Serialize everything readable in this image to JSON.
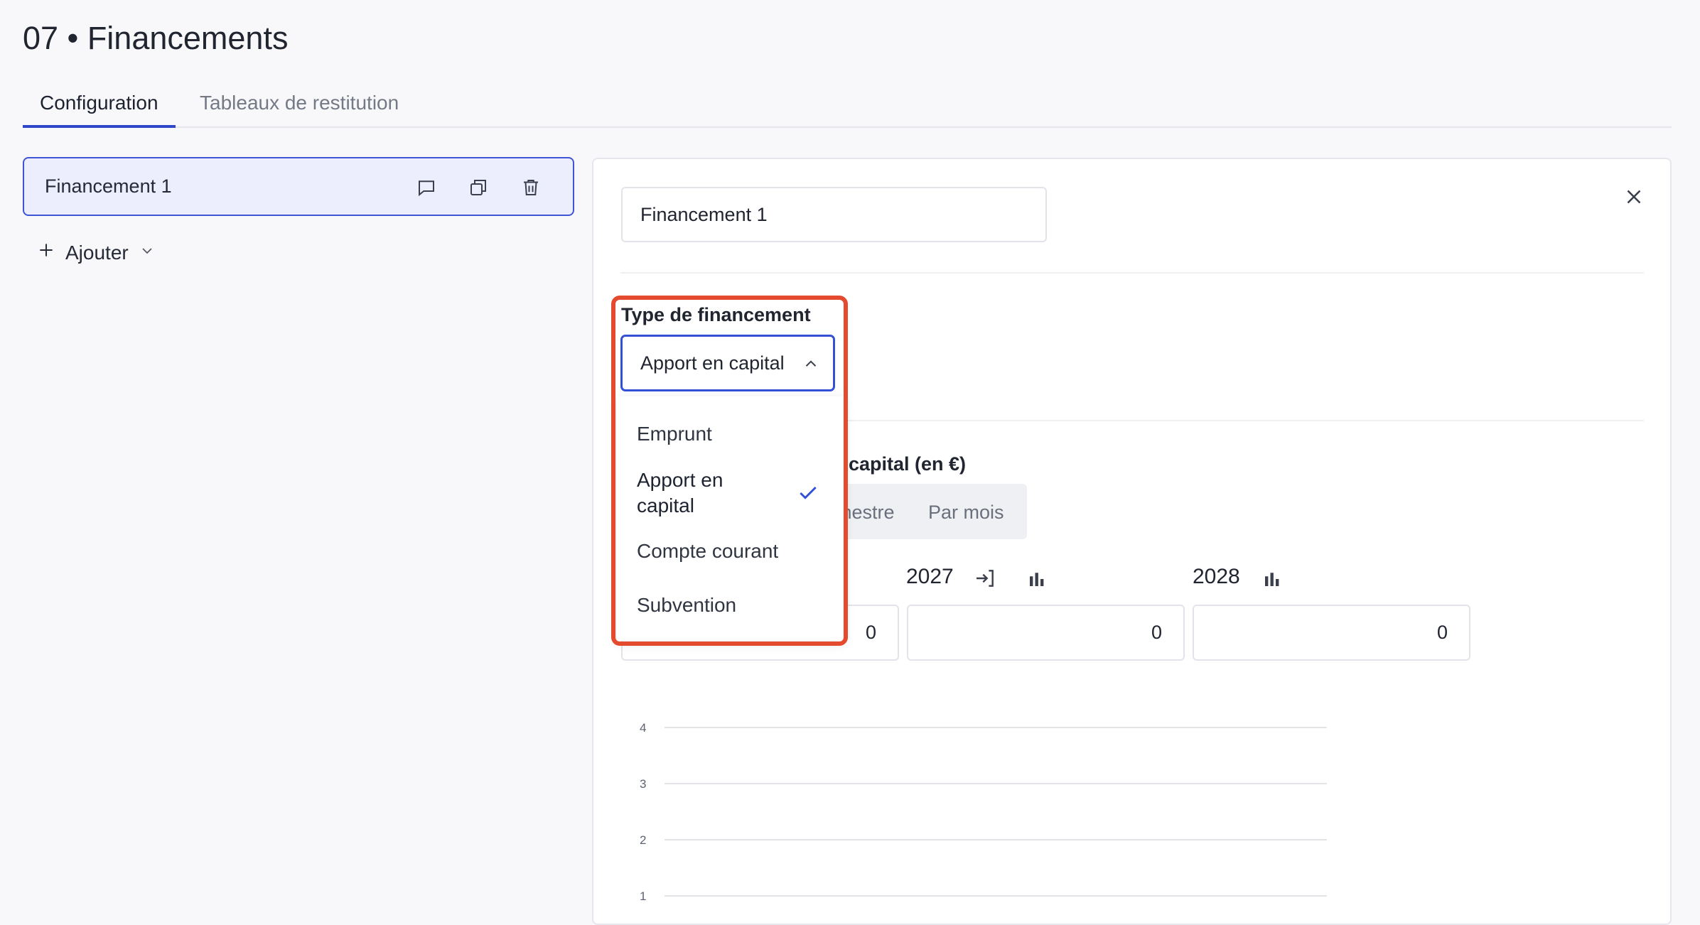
{
  "page": {
    "title": "07 • Financements"
  },
  "tabs": [
    {
      "label": "Configuration",
      "active": true
    },
    {
      "label": "Tableaux de restitution",
      "active": false
    }
  ],
  "sidebar": {
    "items": [
      {
        "label": "Financement 1",
        "icons": [
          "comment-icon",
          "duplicate-icon",
          "trash-icon"
        ]
      }
    ],
    "add_label": "Ajouter"
  },
  "detail": {
    "name_value": "Financement 1",
    "type_label": "Type de financement",
    "type_selected": "Apport en capital",
    "type_options": [
      {
        "label": "Emprunt",
        "selected": false
      },
      {
        "label": "Apport en capital",
        "selected": true
      },
      {
        "label": "Compte courant",
        "selected": false
      },
      {
        "label": "Subvention",
        "selected": false
      }
    ],
    "section_title_partial": "n capital (en €)",
    "period_tabs_partial": [
      "imestre",
      "Par mois"
    ],
    "years": [
      {
        "label": "2027",
        "value": "0"
      },
      {
        "label": "2028",
        "value": "0"
      }
    ],
    "first_value_partial": "0"
  },
  "chart_data": {
    "type": "bar",
    "y_ticks": [
      "4",
      "3",
      "2",
      "1"
    ],
    "ylim": [
      0,
      4
    ],
    "grid": true
  },
  "colors": {
    "accent": "#2f46c9",
    "highlight": "#e34a2e",
    "selected_bg": "#ecedfd"
  }
}
